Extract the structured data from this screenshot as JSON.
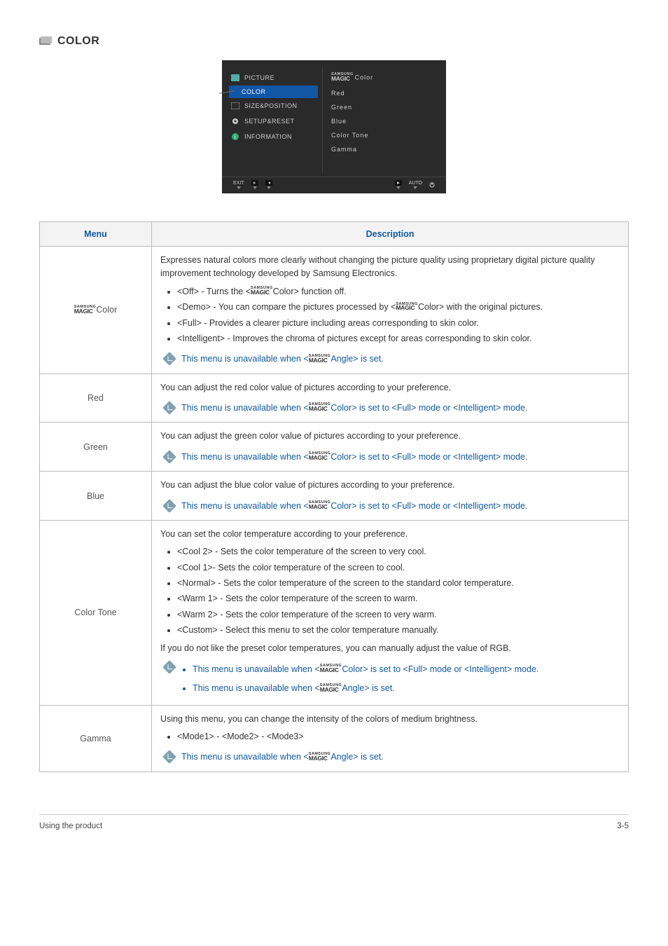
{
  "header": {
    "title": "COLOR"
  },
  "osd": {
    "left": {
      "picture": "PICTURE",
      "color": "COLOR",
      "sizepos": "SIZE&POSITION",
      "setup": "SETUP&RESET",
      "info": "INFORMATION"
    },
    "right": {
      "magiccolor_suffix": "Color",
      "red": "Red",
      "green": "Green",
      "blue": "Blue",
      "colortone": "Color Tone",
      "gamma": "Gamma"
    },
    "bottom": {
      "exit": "EXIT",
      "auto": "AUTO"
    }
  },
  "magic": {
    "l1": "SAMSUNG",
    "l2": "MAGIC"
  },
  "table": {
    "head_menu": "Menu",
    "head_desc": "Description",
    "rows": {
      "magiccolor": {
        "menu_suffix": "Color",
        "intro": "Expresses natural colors more clearly without changing the picture quality using proprietary digital picture quality improvement technology developed by Samsung Electronics.",
        "b1a": "<Off> - Turns the <",
        "b1b": "Color> function off.",
        "b2a": "<Demo> - You can compare the pictures processed by <",
        "b2b": "Color> with the original pictures.",
        "b3": "<Full> - Provides a clearer picture including areas corresponding to skin color.",
        "b4": "<Intelligent> - Improves the chroma of pictures except for areas corresponding to skin color.",
        "note_a": "This menu is unavailable when <",
        "note_b": "Angle> is set."
      },
      "red": {
        "menu": "Red",
        "intro": "You can adjust the red color value of pictures according to your preference.",
        "note_a": "This menu is unavailable when <",
        "note_b": "Color> is set to <Full> mode or <Intelligent> mode."
      },
      "green": {
        "menu": "Green",
        "intro": "You can adjust the green color value of pictures according to your preference.",
        "note_a": "This menu is unavailable when <",
        "note_b": "Color> is set to <Full> mode or <Intelligent> mode."
      },
      "blue": {
        "menu": "Blue",
        "intro": "You can adjust the blue color value of pictures according to your preference.",
        "note_a": "This menu is unavailable when <",
        "note_b": "Color> is set to <Full> mode or <Intelligent> mode."
      },
      "colortone": {
        "menu": "Color Tone",
        "intro": "You can set the color temperature according to your preference.",
        "b1": "<Cool 2> - Sets the color temperature of the screen to very cool.",
        "b2": "<Cool 1>- Sets the color temperature of the screen to cool.",
        "b3": "<Normal> - Sets the color temperature of the screen to the standard color temperature.",
        "b4": "<Warm 1> - Sets the color temperature of the screen to warm.",
        "b5": "<Warm 2> - Sets the color temperature of the screen to very warm.",
        "b6": "<Custom> - Select this menu to set the color temperature manually.",
        "tail": "If you do not like the preset color temperatures, you can manually adjust the value of RGB.",
        "note1_a": "This menu is unavailable when <",
        "note1_b": "Color> is set to <Full> mode or <Intelligent> mode.",
        "note2_a": "This menu is unavailable when <",
        "note2_b": "Angle> is set."
      },
      "gamma": {
        "menu": "Gamma",
        "intro": "Using this menu, you can change the intensity of the colors of medium brightness.",
        "b1": "<Mode1> - <Mode2> - <Mode3>",
        "note_a": "This menu is unavailable when <",
        "note_b": "Angle> is set."
      }
    }
  },
  "footer": {
    "left": "Using the product",
    "right": "3-5"
  }
}
